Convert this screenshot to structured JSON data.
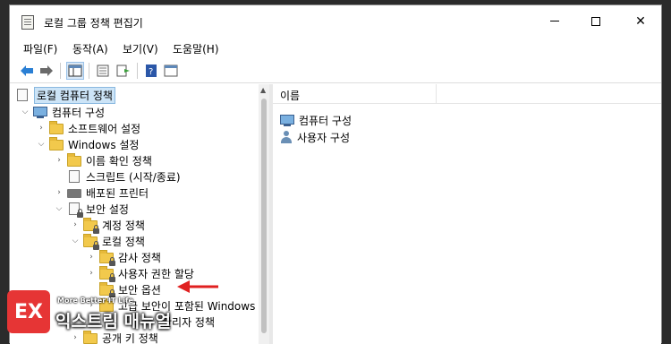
{
  "window": {
    "title": "로컬 그룹 정책 편집기"
  },
  "menubar": [
    "파일(F)",
    "동작(A)",
    "보기(V)",
    "도움말(H)"
  ],
  "toolbar": [
    "back-icon",
    "forward-icon",
    "show-hide-tree-icon",
    "properties-icon",
    "export-list-icon",
    "help-icon",
    "view-icon"
  ],
  "tree": {
    "root": "로컬 컴퓨터 정책",
    "items": {
      "computer_config": "컴퓨터 구성",
      "software_settings": "소프트웨어 설정",
      "windows_settings": "Windows 설정",
      "name_resolution": "이름 확인 정책",
      "scripts": "스크립트 (시작/종료)",
      "deployed_printers": "배포된 프린터",
      "security_settings": "보안 설정",
      "account_policies": "계정 정책",
      "local_policies": "로컬 정책",
      "audit_policy": "감사 정책",
      "user_rights": "사용자 권한 할당",
      "security_options": "보안 옵션",
      "advanced_firewall": "고급 보안이 포함된 Windows D",
      "network_list": "관리자 정책",
      "public_key": "공개 키 정책"
    }
  },
  "right_pane": {
    "column_header": "이름",
    "items": [
      "컴퓨터 구성",
      "사용자 구성"
    ]
  },
  "watermark": {
    "badge": "EX",
    "tagline": "More Better IT Life",
    "brand": "익스트림 매뉴얼"
  },
  "colors": {
    "accent": "#e63535",
    "selection": "#cce4f7",
    "folder": "#f2c94c"
  }
}
